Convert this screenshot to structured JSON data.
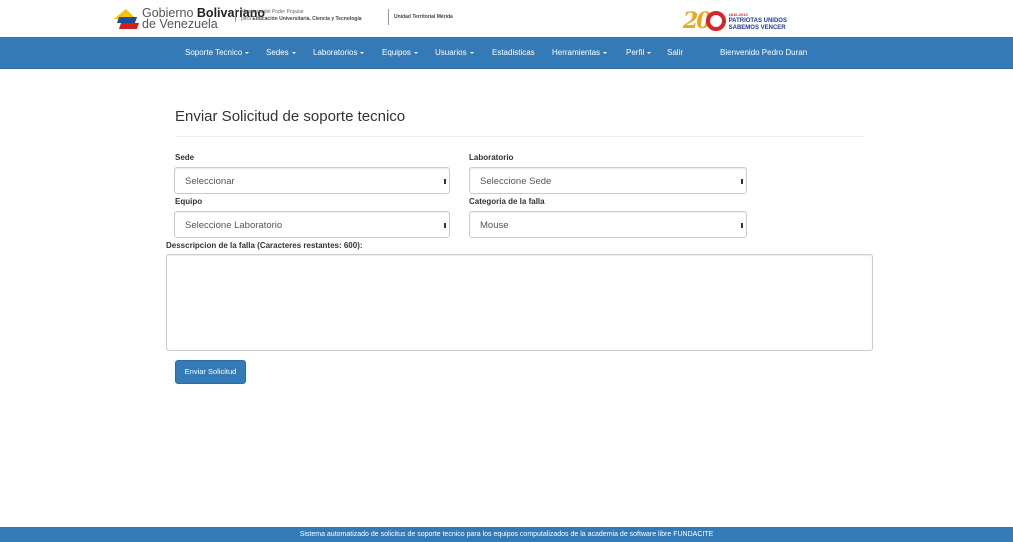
{
  "header": {
    "gov_name_part1": "Gobierno ",
    "gov_name_part2": "Bolivariano",
    "gov_name_line2": "de Venezuela",
    "ministry_line1": "Ministerio del Poder Popular",
    "ministry_prefix": "para ",
    "ministry_line2": "Educación Universitaria, Ciencia y Tecnología",
    "unit": "Unidad Territorial Mérida",
    "bicentenario_num": "20",
    "bicentenario_years": "1810-2010",
    "bicentenario_slogan1": "PATRIOTAS UNIDOS",
    "bicentenario_slogan2": "SABEMOS VENCER"
  },
  "nav": {
    "soporte": "Soporte Tecnico",
    "sedes": "Sedes",
    "laboratorios": "Laboratorios",
    "equipos": "Equipos",
    "usuarios": "Usuarios",
    "estadisticas": "Estadisticas",
    "herramientas": "Herramientas",
    "perfil": "Perfil",
    "salir": "Salir",
    "welcome": "Bienvenido Pedro Duran"
  },
  "form": {
    "title": "Enviar Solicitud de soporte tecnico",
    "sede_label": "Sede",
    "sede_value": "Seleccionar",
    "laboratorio_label": "Laboratorio",
    "laboratorio_value": "Seleccione Sede",
    "equipo_label": "Equipo",
    "equipo_value": "Seleccione Laboratorio",
    "categoria_label": "Categoria de la falla",
    "categoria_value": "Mouse",
    "descripcion_label": "Desscripcion de la falla (Caracteres restantes: 600):",
    "submit": "Enviar Solicitud"
  },
  "footer": {
    "text": "Sistema automatizado de solicitus de soporte tecnico para los equipos computalizados de la academia de software libre FUNDACITE"
  },
  "colors": {
    "primary": "#337ab7",
    "accent_gold": "#e9a91d",
    "accent_red": "#d9232d"
  }
}
